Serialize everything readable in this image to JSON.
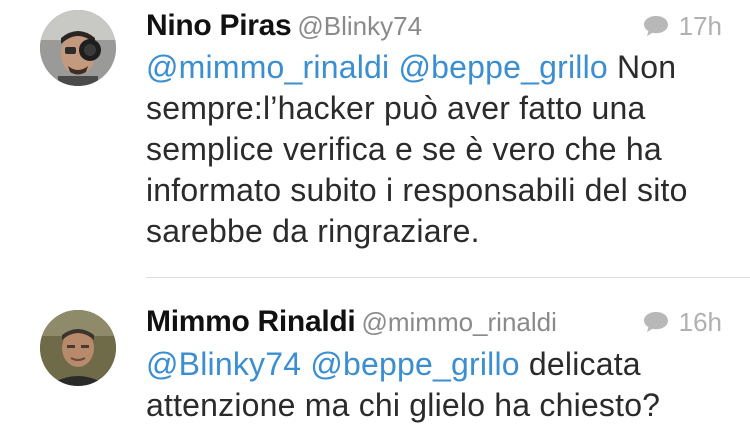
{
  "colors": {
    "mention": "#3b8fd1",
    "name": "#111111",
    "handle": "#8a8a8a",
    "meta": "#b0b0b0",
    "text": "#2b2b2b"
  },
  "tweets": [
    {
      "name": "Nino Piras",
      "handle": "@Blinky74",
      "time": "17h",
      "reply_icon": "speech-bubble-icon",
      "mentions": [
        "@mimmo_rinaldi",
        "@beppe_grillo"
      ],
      "text": "Non sempre:l’hacker può aver fatto una semplice verifica e se è vero che ha informato subito i responsabili del sito sarebbe da ringraziare."
    },
    {
      "name": "Mimmo Rinaldi",
      "handle": "@mimmo_rinaldi",
      "time": "16h",
      "reply_icon": "speech-bubble-icon",
      "mentions": [
        "@Blinky74",
        "@beppe_grillo"
      ],
      "text": "delicata attenzione ma chi glielo ha chiesto?"
    }
  ]
}
